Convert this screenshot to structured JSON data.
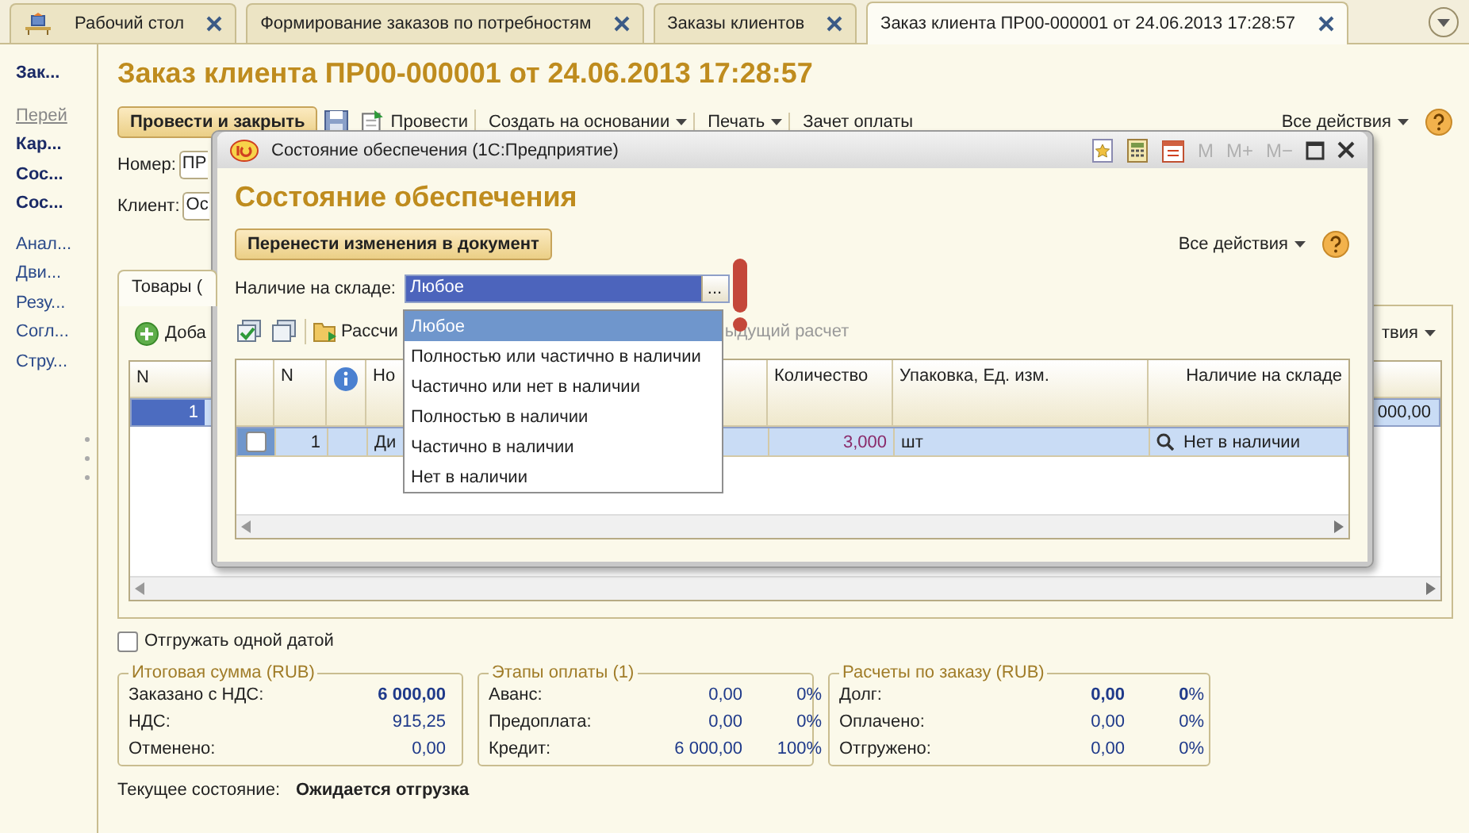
{
  "tabs": [
    {
      "label": "Рабочий стол",
      "kind": "desktop",
      "selected": false
    },
    {
      "label": "Формирование заказов по потребностям",
      "kind": "plain",
      "selected": false
    },
    {
      "label": "Заказы клиентов",
      "kind": "plain",
      "selected": false
    },
    {
      "label": "Заказ клиента ПР00-000001 от 24.06.2013 17:28:57",
      "kind": "plain",
      "selected": true
    }
  ],
  "sidebar": {
    "items": [
      {
        "label": "Зак...",
        "kind": "bold"
      },
      {
        "label": "Перей",
        "kind": "header"
      },
      {
        "label": "Кар...",
        "kind": "bold"
      },
      {
        "label": "Сос...",
        "kind": "bold"
      },
      {
        "label": "Сос...",
        "kind": "bold"
      },
      {
        "label": "Анал...",
        "kind": "link"
      },
      {
        "label": "Дви...",
        "kind": "link"
      },
      {
        "label": "Резу...",
        "kind": "link"
      },
      {
        "label": "Согл...",
        "kind": "link"
      },
      {
        "label": "Стру...",
        "kind": "link"
      }
    ]
  },
  "form": {
    "title": "Заказ клиента ПР00-000001 от 24.06.2013 17:28:57",
    "toolbar": [
      {
        "label": "Провести и закрыть",
        "kind": "default"
      },
      {
        "kind": "save"
      },
      {
        "label": "Провести",
        "kind": "post"
      },
      {
        "label": "Создать на основании",
        "kind": "menu"
      },
      {
        "label": "Печать",
        "kind": "menu"
      },
      {
        "label": "Зачет оплаты",
        "kind": "plain"
      }
    ],
    "all_actions": "Все действия",
    "fields": [
      {
        "label": "Номер:",
        "value": "ПР"
      },
      {
        "label": "Клиент:",
        "value": "Ос"
      }
    ],
    "tabs": [
      {
        "label": "Товары (",
        "selected": true
      }
    ],
    "goods": {
      "add_button": "Доба",
      "actions": "твия",
      "columns": [
        "N"
      ],
      "rows": [
        {
          "n": "1",
          "column_2": "000,00",
          "selected": true
        }
      ]
    },
    "ship_one_date": {
      "label": "Отгружать одной датой",
      "checked": false
    },
    "groups": [
      {
        "title": "Итоговая сумма (RUB)",
        "rows": [
          {
            "label": "Заказано с НДС:",
            "value": "6 000,00",
            "bold": true
          },
          {
            "label": "НДС:",
            "value": "915,25",
            "bold": false
          },
          {
            "label": "Отменено:",
            "value": "0,00",
            "bold": false
          }
        ]
      },
      {
        "title": "Этапы оплаты (1)",
        "rows": [
          {
            "label": "Аванс:",
            "value": "0,00",
            "percent": "0%",
            "bold": false
          },
          {
            "label": "Предоплата:",
            "value": "0,00",
            "percent": "0%",
            "bold": false
          },
          {
            "label": "Кредит:",
            "value": "6 000,00",
            "percent": "100%",
            "bold": false
          }
        ]
      },
      {
        "title": "Расчеты по заказу (RUB)",
        "rows": [
          {
            "label": "Долг:",
            "value": "0,00",
            "percent": "**0**%",
            "bold": true
          },
          {
            "label": "Оплачено:",
            "value": "0,00",
            "percent": "0%",
            "bold": false
          },
          {
            "label": "Отгружено:",
            "value": "0,00",
            "percent": "0%",
            "bold": false
          }
        ]
      }
    ],
    "status": {
      "label": "Текущее состояние:",
      "value": "Ожидается отгрузка"
    }
  },
  "modal": {
    "title": "Состояние обеспечения (1С:Предприятие)",
    "memory_buttons": [
      {
        "label": "M",
        "disabled": true
      },
      {
        "label": "M+",
        "disabled": true
      },
      {
        "label": "M−",
        "disabled": true
      }
    ],
    "heading": "Состояние обеспечения",
    "apply_button": "Перенести изменения в документ",
    "all_actions": "Все действия",
    "filter": {
      "label": "Наличие на складе:",
      "value": "Любое",
      "choose_button": "...",
      "expanded": true,
      "options": [
        {
          "label": "Любое",
          "selected": true
        },
        {
          "label": "Полностью или частично в наличии",
          "selected": false
        },
        {
          "label": "Частично или нет в наличии",
          "selected": false
        },
        {
          "label": "Полностью в наличии",
          "selected": false
        },
        {
          "label": "Частично в наличии",
          "selected": false
        },
        {
          "label": "Нет в наличии",
          "selected": false
        }
      ]
    },
    "toolbar": {
      "calculate": "Рассчи",
      "previous": "ыдущий расчет"
    },
    "table": {
      "columns": [
        "N",
        "Но",
        "Количество",
        "Упаковка, Ед. изм.",
        "Наличие на складе"
      ],
      "rows": [
        {
          "checked": false,
          "selected": true,
          "n": "1",
          "name": "Ди",
          "quantity": "3,000",
          "unit": "шт",
          "availability": "Нет в наличии"
        }
      ]
    }
  }
}
